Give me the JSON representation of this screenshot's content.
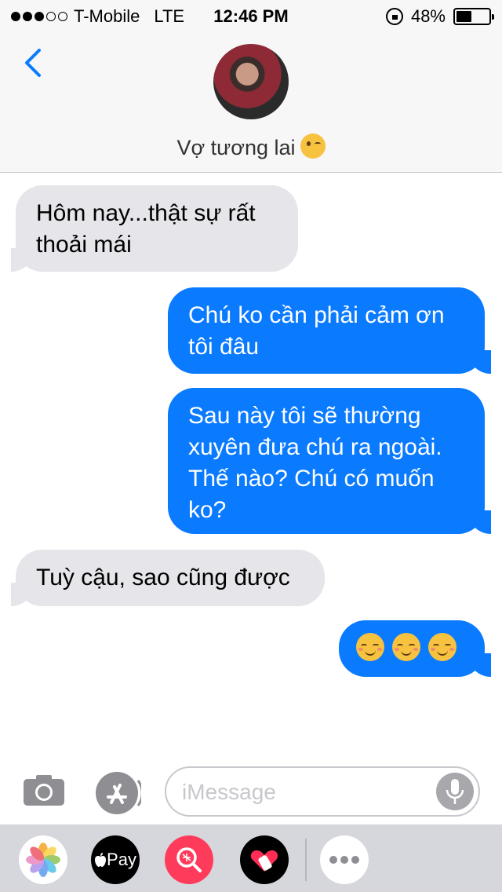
{
  "status_bar": {
    "carrier": "T-Mobile",
    "network": "LTE",
    "time": "12:46 PM",
    "battery_percent": "48%",
    "battery_level": 0.48,
    "signal_bars_filled": 3,
    "signal_bars_total": 5
  },
  "header": {
    "contact_name": "Vợ tương lai",
    "contact_emoji": "wink-emoji"
  },
  "messages": [
    {
      "direction": "incoming",
      "lines": [
        "Hôm nay...thật sự rất",
        "thoải mái"
      ]
    },
    {
      "direction": "outgoing",
      "lines": [
        "Chú ko cần phải cảm ơn",
        "tôi đâu"
      ]
    },
    {
      "direction": "outgoing",
      "lines": [
        "Sau này tôi sẽ thường",
        "xuyên đưa chú ra ngoài.",
        "Thế nào? Chú có muốn",
        "ko?"
      ]
    },
    {
      "direction": "incoming",
      "lines": [
        "Tuỳ cậu, sao cũng được"
      ]
    },
    {
      "direction": "outgoing",
      "emojis": [
        "smiling-face-emoji",
        "smiling-face-emoji",
        "smiling-face-emoji"
      ]
    }
  ],
  "input": {
    "placeholder": "iMessage"
  },
  "app_drawer": {
    "apple_pay_label": "Pay",
    "apps": [
      "photos-icon",
      "apple-pay-icon",
      "search-images-icon",
      "digital-touch-icon",
      "more-icon"
    ]
  },
  "colors": {
    "outgoing_bubble": "#0a7aff",
    "incoming_bubble": "#e5e5ea",
    "accent": "#0a7aff"
  }
}
